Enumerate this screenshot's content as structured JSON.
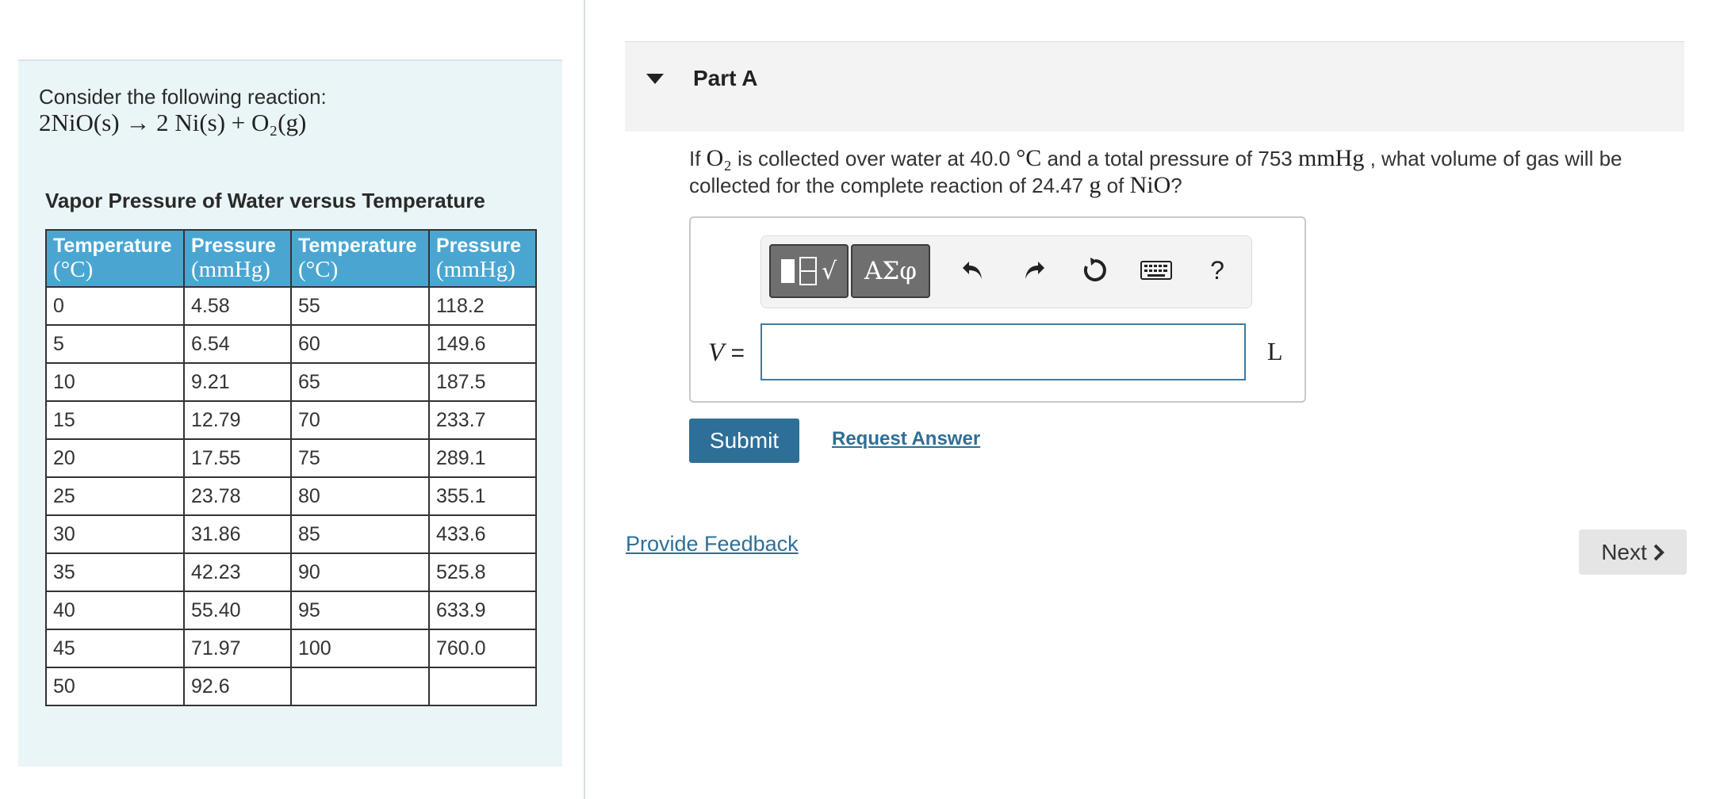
{
  "problem": {
    "intro": "Consider the following reaction:",
    "reaction": "2NiO(s) → 2 Ni(s) + O₂(g)"
  },
  "vapor_table": {
    "title": "Vapor Pressure of Water versus Temperature",
    "headers": [
      {
        "name": "Temperature",
        "unit": "(°C)"
      },
      {
        "name": "Pressure",
        "unit": "(mmHg)"
      },
      {
        "name": "Temperature",
        "unit": "(°C)"
      },
      {
        "name": "Pressure",
        "unit": "(mmHg)"
      }
    ],
    "rows": [
      [
        "0",
        "4.58",
        "55",
        "118.2"
      ],
      [
        "5",
        "6.54",
        "60",
        "149.6"
      ],
      [
        "10",
        "9.21",
        "65",
        "187.5"
      ],
      [
        "15",
        "12.79",
        "70",
        "233.7"
      ],
      [
        "20",
        "17.55",
        "75",
        "289.1"
      ],
      [
        "25",
        "23.78",
        "80",
        "355.1"
      ],
      [
        "30",
        "31.86",
        "85",
        "433.6"
      ],
      [
        "35",
        "42.23",
        "90",
        "525.8"
      ],
      [
        "40",
        "55.40",
        "95",
        "633.9"
      ],
      [
        "45",
        "71.97",
        "100",
        "760.0"
      ],
      [
        "50",
        "92.6",
        "",
        ""
      ]
    ]
  },
  "part": {
    "title": "Part A"
  },
  "question": {
    "t1": "If ",
    "o2": "O₂",
    "t2": " is collected over water at 40.0 ",
    "temp_unit": "°C",
    "t3": " and a total pressure of 753 ",
    "pressure_unit": "mmHg",
    "t4": " , what volume of gas will be collected for the complete reaction of 24.47 ",
    "mass_unit": "g",
    "t5": " of ",
    "compound": "NiO",
    "t6": "?"
  },
  "toolbar": {
    "templates_icon": "templates-icon",
    "greek_label": "ΑΣφ",
    "undo_icon": "undo-icon",
    "redo_icon": "redo-icon",
    "reset_icon": "reset-icon",
    "keyboard_icon": "keyboard-icon",
    "help_label": "?"
  },
  "answer": {
    "variable": "V",
    "equals": " =",
    "value": "",
    "unit": "L"
  },
  "actions": {
    "submit_label": "Submit",
    "request_answer_label": "Request Answer",
    "feedback_label": "Provide Feedback",
    "next_label": "Next"
  },
  "colors": {
    "table_header": "#4aa6d1",
    "panel_bg": "#eaf5f7",
    "primary": "#2e6f97",
    "link": "#2e6f97"
  }
}
